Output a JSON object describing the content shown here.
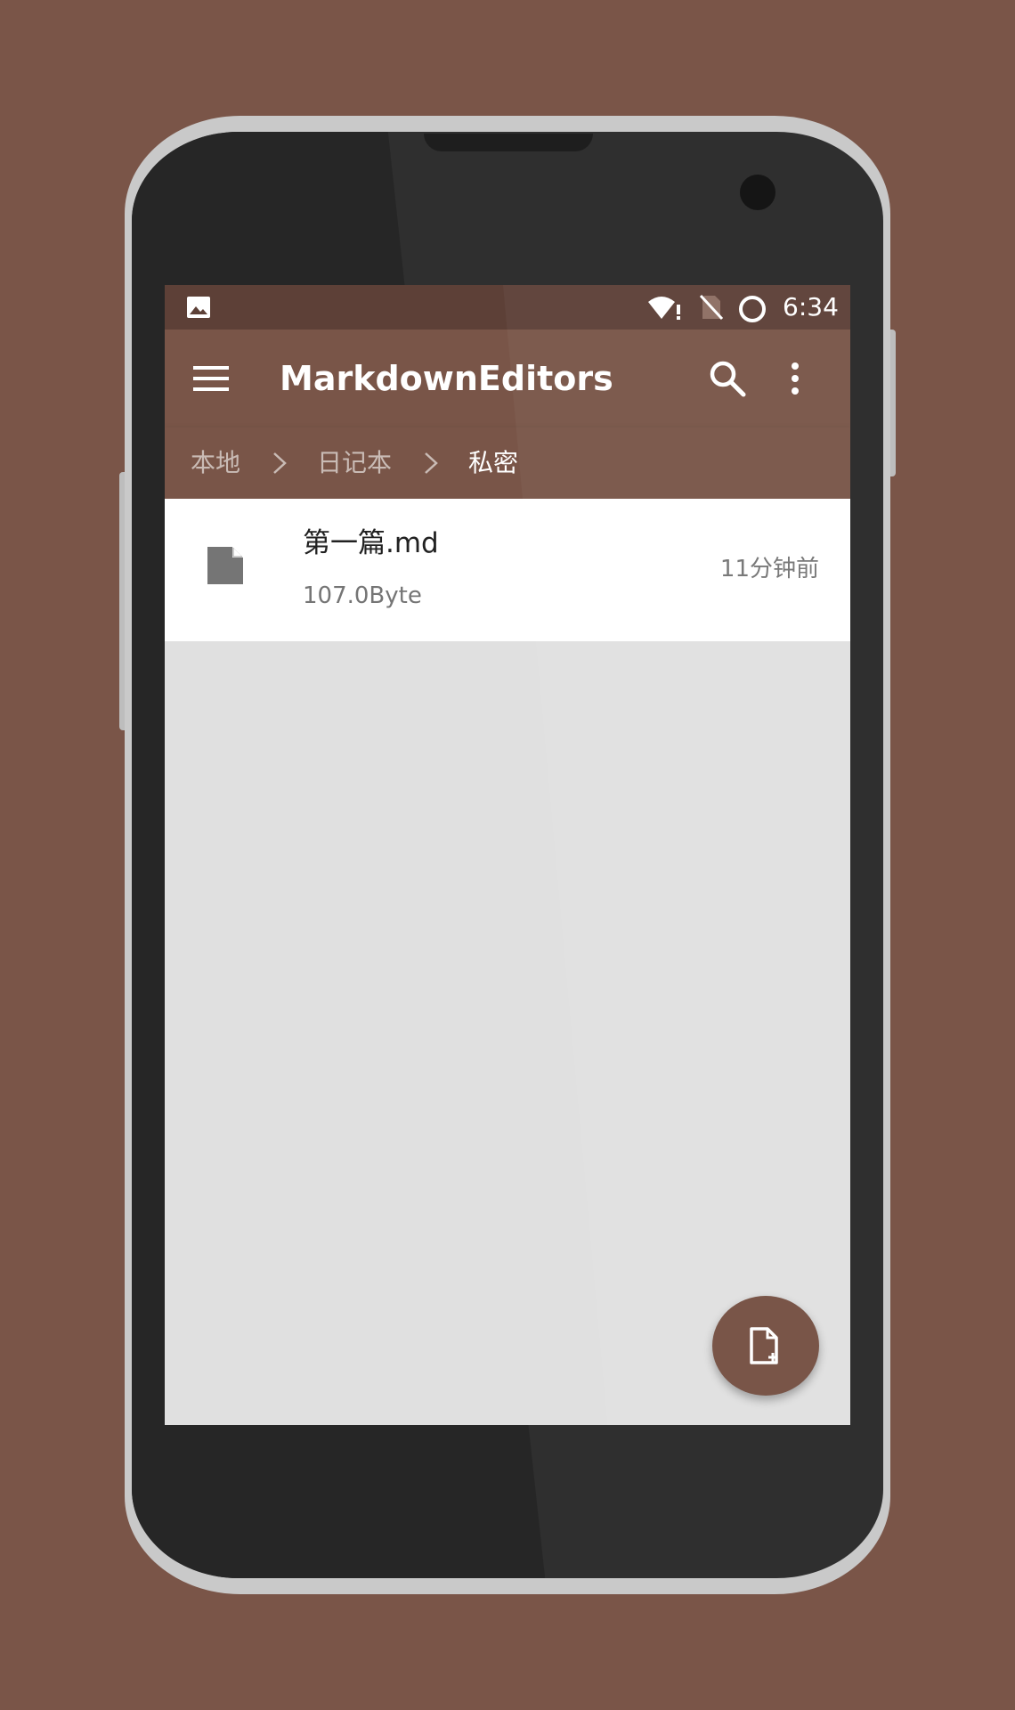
{
  "status_bar": {
    "time": "6:34",
    "icons": [
      "image-notification-icon",
      "wifi-icon",
      "no-sim-icon",
      "sync-circle-icon"
    ]
  },
  "toolbar": {
    "title": "MarkdownEditors",
    "menu_icon": "hamburger-menu-icon",
    "search_icon": "search-icon",
    "more_icon": "more-vertical-icon"
  },
  "breadcrumb": {
    "items": [
      "本地",
      "日记本",
      "私密"
    ],
    "separator_icon": "chevron-right-icon"
  },
  "files": [
    {
      "name": "第一篇.md",
      "size": "107.0Byte",
      "modified": "11分钟前",
      "icon": "file-icon"
    }
  ],
  "fab": {
    "icon": "new-file-icon"
  },
  "colors": {
    "primary": "#795548",
    "primary_dark": "#5d4037",
    "background": "#e0e0e0",
    "page_background": "#7a5548"
  }
}
